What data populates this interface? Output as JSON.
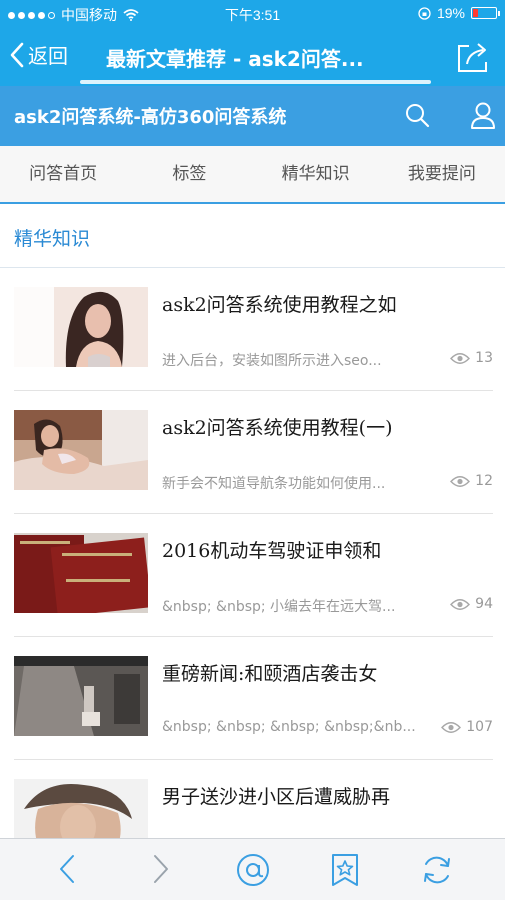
{
  "status": {
    "carrier": "中国移动",
    "time": "下午3:51",
    "battery_percent": "19%",
    "battery_level": 0.19,
    "signal_bars_filled": 4
  },
  "nav": {
    "back_label": "返回",
    "title": "最新文章推荐 - ask2问答...",
    "page_load_progress": 0.9
  },
  "site": {
    "title": "ask2问答系统-高仿360问答系统"
  },
  "menu": [
    {
      "label": "问答首页"
    },
    {
      "label": "标签"
    },
    {
      "label": "精华知识"
    },
    {
      "label": "我要提问"
    }
  ],
  "section_title": "精华知识",
  "articles": [
    {
      "title": "ask2问答系统使用教程之如",
      "desc": "进入后台，安装如图所示进入seo...",
      "views": "13",
      "thumb": "woman-portrait-photo"
    },
    {
      "title": "ask2问答系统使用教程(一)",
      "desc": "新手会不知道导航条功能如何使用...",
      "views": "12",
      "thumb": "woman-on-bed-photo"
    },
    {
      "title": "2016机动车驾驶证申领和",
      "desc": "&nbsp; &nbsp; 小编去年在远大驾...",
      "views": "94",
      "thumb": "driving-license-photo"
    },
    {
      "title": "重磅新闻:和颐酒店袭击女",
      "desc": "&nbsp; &nbsp; &nbsp; &nbsp;&nb...",
      "views": "107",
      "thumb": "cctv-hallway-photo"
    },
    {
      "title": "男子送沙进小区后遭威胁再",
      "desc": "",
      "views": "",
      "thumb": "man-in-fur-hat-photo"
    }
  ],
  "colors": {
    "nav_blue": "#1ea7e8",
    "site_blue": "#3b9fe2",
    "section_text": "#2a8ad4"
  },
  "icons": [
    "back-chevron-icon",
    "share-icon",
    "search-icon",
    "user-icon",
    "eye-icon",
    "browser-back-icon",
    "browser-forward-icon",
    "at-sign-icon",
    "bookmark-star-icon",
    "refresh-icon"
  ]
}
